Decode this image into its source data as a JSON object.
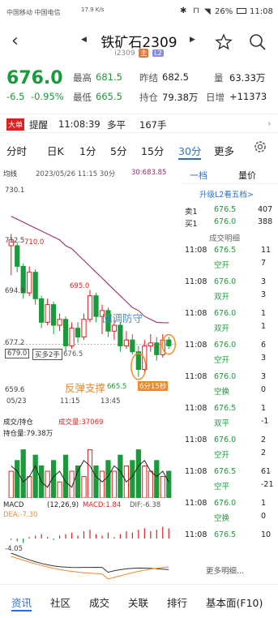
{
  "status_bar": {
    "left": "中国移动 中国电信",
    "speed": "17.9 K/s",
    "battery": "26%",
    "time": "11:08"
  },
  "header": {
    "title": "铁矿石2309",
    "subtitle": "i2309",
    "tag1": "主",
    "tag2": "L2"
  },
  "quote": {
    "price": "676.0",
    "change": "-6.5",
    "change_pct": "-0.95%",
    "high_label": "最高",
    "high": "681.5",
    "low_label": "最低",
    "low": "665.5",
    "prev_label": "昨结",
    "prev": "682.5",
    "oi_label": "持仓",
    "oi": "79.38万",
    "vol_label": "量",
    "vol": "63.33万",
    "daily_label": "日增",
    "daily": "+11373"
  },
  "alert": {
    "badge": "大单",
    "label": "提醒",
    "time": "11:08:39",
    "side": "多平",
    "qty": "167手"
  },
  "period_tabs": [
    "分时",
    "日K",
    "1分",
    "5分",
    "15分",
    "30分",
    "更多"
  ],
  "chart": {
    "indicator": "均线",
    "info": "2023/05/26 11:15 30分",
    "ma_value": "30:683.85",
    "y_ticks": [
      "730.1",
      "712.5",
      "694.9",
      "677.2",
      "659.6"
    ],
    "ma_label": "710.0",
    "peak_label": "695.0",
    "low_label": "665.5",
    "ref_label": "676.5",
    "cursor_price": "679.0",
    "cursor_order": "买多2手",
    "ann_top": "回调防守",
    "ann_bottom": "反弹支撑",
    "countdown": "6分15秒",
    "x_ticks": [
      "05/23",
      "11:15",
      "13:45"
    ]
  },
  "volume": {
    "tab": "成交/持仓",
    "vol_label": "成交量:37069",
    "oi_label": "持仓量:79.38万"
  },
  "macd": {
    "label": "MACD",
    "params": "(12,26,9)",
    "macd": "MACD:1.84",
    "dif": "DIF:-6.38",
    "dea": "DEA:-7.30",
    "tick": "-4.05"
  },
  "right_tabs": [
    "一档",
    "量价"
  ],
  "book": {
    "upgrade": "升级L2看五档>",
    "sell_label": "卖1",
    "sell_price": "676.5",
    "sell_qty": "407",
    "buy_label": "买1",
    "buy_price": "676.0",
    "buy_qty": "388"
  },
  "trades_title": "成交明细",
  "trades": [
    {
      "t": "11:08",
      "p": "676.5",
      "q": "11",
      "type": "空开",
      "d": "7"
    },
    {
      "t": "11:08",
      "p": "676.0",
      "q": "3",
      "type": "双开",
      "d": "3"
    },
    {
      "t": "11:08",
      "p": "676.0",
      "q": "1",
      "type": "双开",
      "d": "1"
    },
    {
      "t": "11:08",
      "p": "676.0",
      "q": "6",
      "type": "空开",
      "d": "3"
    },
    {
      "t": "11:08",
      "p": "676.0",
      "q": "3",
      "type": "空换",
      "d": "0"
    },
    {
      "t": "11:08",
      "p": "676.5",
      "q": "1",
      "type": "双平",
      "d": "-1"
    },
    {
      "t": "11:08",
      "p": "676.0",
      "q": "2",
      "type": "空开",
      "d": "2"
    },
    {
      "t": "11:08",
      "p": "676.5",
      "q": "61",
      "type": "空平",
      "d": "-21"
    },
    {
      "t": "11:08",
      "p": "676.0",
      "q": "1",
      "type": "空换",
      "d": "0"
    },
    {
      "t": "11:08",
      "p": "676.5",
      "q": "10",
      "type": "",
      "d": ""
    }
  ],
  "more_detail": "更多明细...",
  "bottom_tabs": [
    "资讯",
    "社区",
    "成交",
    "关联",
    "排行",
    "基本面(F10)"
  ],
  "candles": [
    {
      "o": 710,
      "c": 712,
      "h": 714,
      "l": 700
    },
    {
      "o": 710,
      "c": 703,
      "h": 711,
      "l": 701
    },
    {
      "o": 703,
      "c": 694,
      "h": 704,
      "l": 692
    },
    {
      "o": 694,
      "c": 701,
      "h": 703,
      "l": 693
    },
    {
      "o": 701,
      "c": 692,
      "h": 702,
      "l": 690
    },
    {
      "o": 692,
      "c": 684,
      "h": 693,
      "l": 682
    },
    {
      "o": 684,
      "c": 690,
      "h": 692,
      "l": 683
    },
    {
      "o": 690,
      "c": 683,
      "h": 691,
      "l": 680
    },
    {
      "o": 683,
      "c": 685,
      "h": 687,
      "l": 681
    },
    {
      "o": 685,
      "c": 676,
      "h": 686,
      "l": 674
    },
    {
      "o": 676,
      "c": 682,
      "h": 684,
      "l": 675
    },
    {
      "o": 682,
      "c": 679,
      "h": 684,
      "l": 677
    },
    {
      "o": 679,
      "c": 685,
      "h": 687,
      "l": 678
    },
    {
      "o": 685,
      "c": 693,
      "h": 695,
      "l": 684
    },
    {
      "o": 693,
      "c": 686,
      "h": 694,
      "l": 684
    },
    {
      "o": 686,
      "c": 688,
      "h": 690,
      "l": 680
    },
    {
      "o": 688,
      "c": 681,
      "h": 689,
      "l": 679
    },
    {
      "o": 681,
      "c": 683,
      "h": 685,
      "l": 678
    },
    {
      "o": 683,
      "c": 676,
      "h": 684,
      "l": 674
    },
    {
      "o": 676,
      "c": 678,
      "h": 681,
      "l": 675
    },
    {
      "o": 678,
      "c": 674,
      "h": 680,
      "l": 673
    },
    {
      "o": 674,
      "c": 668,
      "h": 676,
      "l": 665.5
    },
    {
      "o": 668,
      "c": 676,
      "h": 678,
      "l": 667
    },
    {
      "o": 676,
      "c": 677,
      "h": 680,
      "l": 674
    },
    {
      "o": 677,
      "c": 673,
      "h": 679,
      "l": 671
    },
    {
      "o": 673,
      "c": 678,
      "h": 680,
      "l": 672
    },
    {
      "o": 678,
      "c": 676,
      "h": 679,
      "l": 675
    }
  ],
  "ma": [
    720,
    719,
    718,
    717,
    716,
    715,
    714,
    713,
    712,
    710,
    709,
    707,
    705,
    703,
    701,
    699,
    697,
    695,
    693,
    691,
    689,
    688,
    686,
    685,
    684,
    683.9,
    683.85
  ],
  "vols": [
    0.5,
    0.7,
    0.9,
    0.4,
    0.8,
    0.6,
    0.5,
    0.7,
    0.3,
    0.8,
    0.5,
    0.6,
    0.4,
    0.9,
    0.6,
    0.5,
    0.7,
    0.5,
    0.8,
    0.6,
    0.7,
    0.9,
    0.6,
    0.5,
    0.7,
    0.4,
    0.5
  ],
  "oi_line": [
    0.6,
    0.5,
    0.3,
    0.4,
    0.6,
    0.3,
    0.2,
    0.4,
    0.5,
    0.3,
    0.2,
    0.5,
    0.7,
    0.6,
    0.4,
    0.3,
    0.4,
    0.6,
    0.5,
    0.3,
    0.4,
    0.6,
    0.7,
    0.5,
    0.4,
    0.5,
    0.3
  ],
  "macd_bars": [
    -0.1,
    -0.2,
    -0.3,
    0.1,
    0.2,
    0.3,
    0.1,
    -0.1,
    0.2,
    0.3,
    0.4,
    0.2,
    0.5,
    0.6,
    0.3,
    0.2,
    0.4,
    0.1,
    0.3,
    0.5,
    0.4,
    0.6,
    0.7,
    0.5,
    0.6,
    0.8,
    0.7
  ],
  "colors": {
    "up": "#e02020",
    "down": "#1a9a3a",
    "ma": "#9b2d6b",
    "accent": "#2a6fd6",
    "orange": "#f08a2a"
  }
}
